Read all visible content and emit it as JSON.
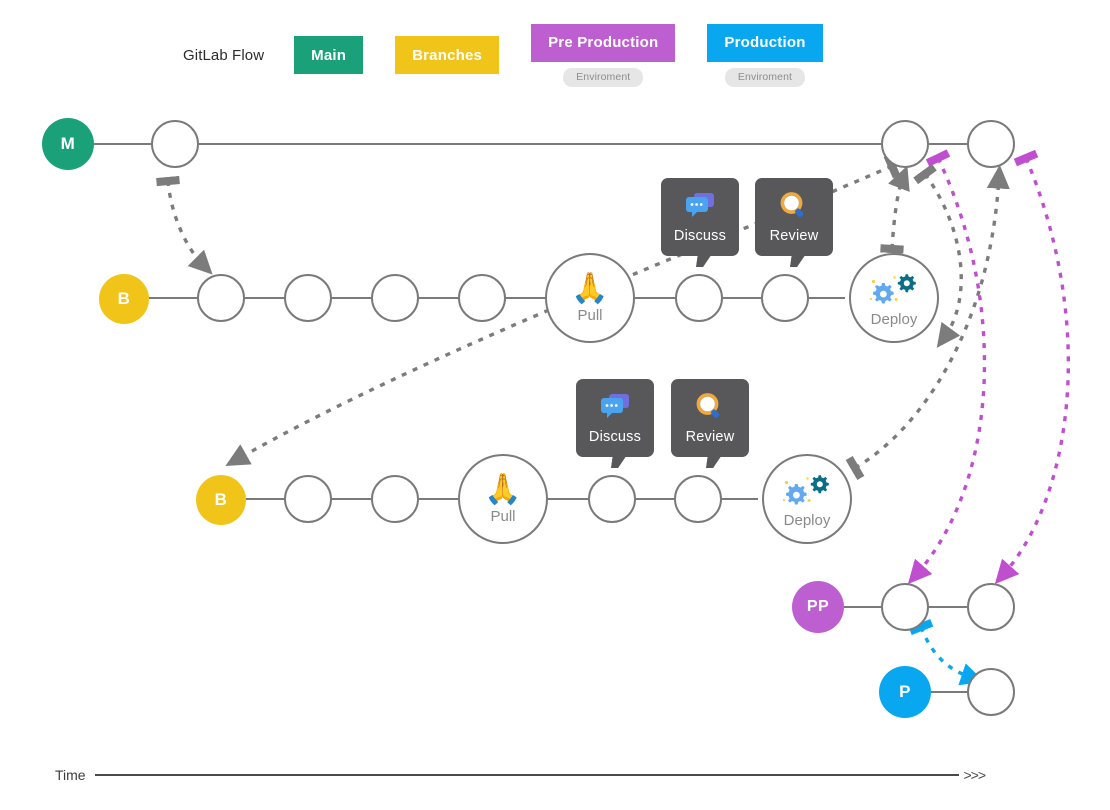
{
  "legend": {
    "title": "GitLab Flow",
    "chips": [
      {
        "label": "Main",
        "color": "#1aa179",
        "env": null
      },
      {
        "label": "Branches",
        "color": "#f0c419",
        "env": null
      },
      {
        "label": "Pre Production",
        "color": "#bd5fd1",
        "env": "Enviroment"
      },
      {
        "label": "Production",
        "color": "#09a7f0",
        "env": "Enviroment"
      }
    ]
  },
  "branches": {
    "main": {
      "badge": "M",
      "color": "#1aa179"
    },
    "branch_one": {
      "badge": "B",
      "color": "#f0c419"
    },
    "branch_two": {
      "badge": "B",
      "color": "#f0c419"
    },
    "pre_production": {
      "badge": "PP",
      "color": "#bd5fd1"
    },
    "production": {
      "badge": "P",
      "color": "#09a7f0"
    }
  },
  "nodes": {
    "pull_one": {
      "label": "Pull",
      "icon": "folded-hands-emoji"
    },
    "pull_two": {
      "label": "Pull",
      "icon": "folded-hands-emoji"
    },
    "deploy_one": {
      "label": "Deploy",
      "icon": "gears-icon"
    },
    "deploy_two": {
      "label": "Deploy",
      "icon": "gears-icon"
    }
  },
  "tooltips": {
    "discuss_one": {
      "label": "Discuss",
      "icon": "speech-balloon-icon"
    },
    "review_one": {
      "label": "Review",
      "icon": "magnifying-glass-icon"
    },
    "discuss_two": {
      "label": "Discuss",
      "icon": "speech-balloon-icon"
    },
    "review_two": {
      "label": "Review",
      "icon": "magnifying-glass-icon"
    }
  },
  "axis": {
    "label": "Time",
    "arrows": ">>>"
  },
  "colors": {
    "commit_stroke": "#7a7a7a",
    "flow_gray": "#7c7c7c",
    "flow_purple": "#c04fd0",
    "flow_blue": "#08a8f0",
    "tooltip_bg": "#58585a",
    "env_badge_bg": "#e6e6e6"
  }
}
